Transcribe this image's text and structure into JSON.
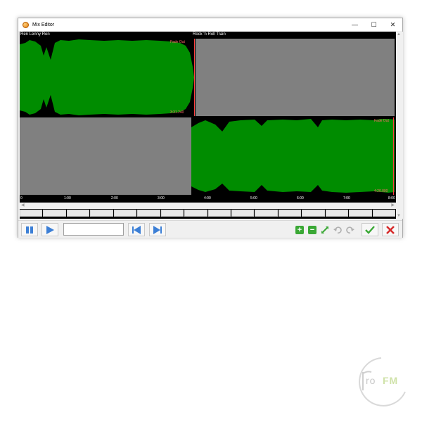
{
  "window": {
    "title": "Mix Editor",
    "controls": {
      "minimize": "—",
      "maximize": "☐",
      "close": "✕"
    }
  },
  "tracks": [
    {
      "name": "Ren Lenny Ren",
      "fade_label": "Fade Out",
      "time_label": "3:31.240"
    },
    {
      "name": "Rock 'n Roll Train",
      "fade_label": "Fade Out",
      "time_label": "4:20.000"
    }
  ],
  "timeline": {
    "ticks": [
      "0",
      "1:00",
      "2:00",
      "3:00",
      "4:00",
      "5:00",
      "6:00",
      "7:00",
      "8:00"
    ]
  },
  "toolbar": {
    "time_input_value": "",
    "icons": [
      "pause-icon",
      "play-icon",
      "skip-start-icon",
      "skip-end-icon",
      "zoom-in-icon",
      "zoom-out-icon",
      "fit-icon",
      "undo-icon",
      "redo-icon",
      "confirm-icon",
      "cancel-icon"
    ]
  },
  "logo": {
    "text_prefix": "ro",
    "text_suffix": "FM"
  },
  "colors": {
    "waveform": "#008c00",
    "lane_empty": "#808080",
    "marker": "#ff4040",
    "play_blue": "#3c7fd6",
    "confirm_green": "#3aa835",
    "cancel_red": "#d62b2b"
  }
}
